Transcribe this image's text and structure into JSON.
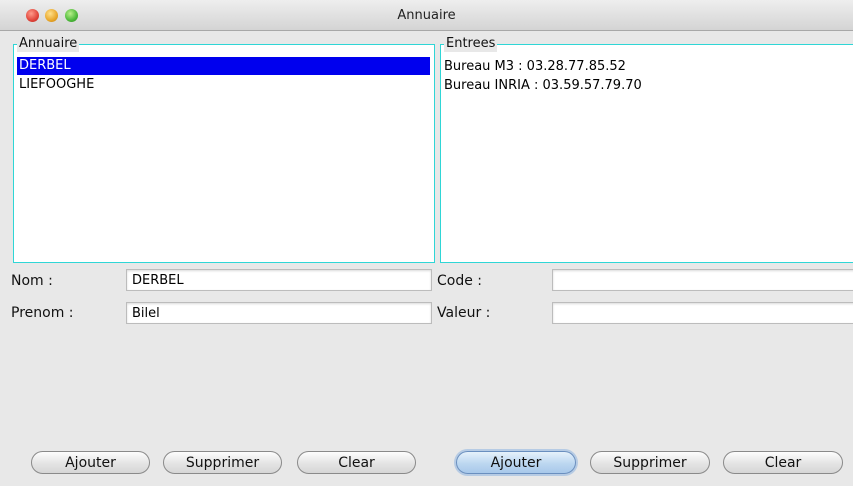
{
  "window": {
    "title": "Annuaire"
  },
  "annuaire": {
    "legend": "Annuaire",
    "items": [
      {
        "label": "DERBEL",
        "selected": true
      },
      {
        "label": "LIEFOOGHE",
        "selected": false
      }
    ]
  },
  "entrees": {
    "legend": "Entrees",
    "items": [
      "Bureau M3 : 03.28.77.85.52",
      "Bureau INRIA : 03.59.57.79.70"
    ]
  },
  "form": {
    "nom_label": "Nom :",
    "nom_value": "DERBEL",
    "prenom_label": "Prenom :",
    "prenom_value": "Bilel",
    "code_label": "Code :",
    "code_value": "",
    "valeur_label": "Valeur :",
    "valeur_value": ""
  },
  "buttons": {
    "left": {
      "add": "Ajouter",
      "remove": "Supprimer",
      "clear": "Clear"
    },
    "right": {
      "add": "Ajouter",
      "remove": "Supprimer",
      "clear": "Clear"
    }
  },
  "colors": {
    "selection": "#0000ee",
    "group_border": "#2fd6d6"
  }
}
